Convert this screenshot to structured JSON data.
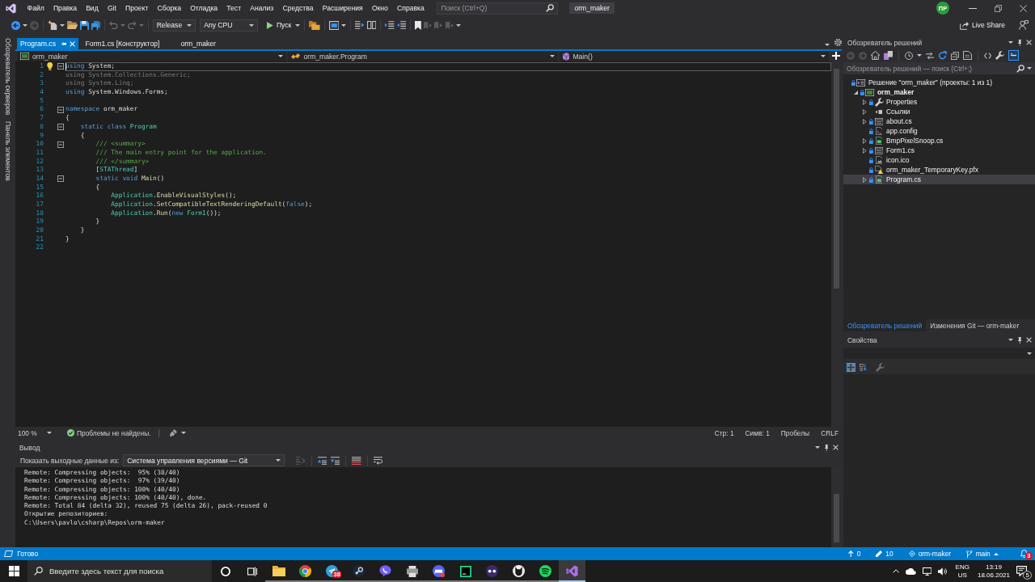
{
  "title_bar": {
    "menu": [
      "Файл",
      "Правка",
      "Вид",
      "Git",
      "Проект",
      "Сборка",
      "Отладка",
      "Тест",
      "Анализ",
      "Средства",
      "Расширения",
      "Окно",
      "Справка"
    ],
    "search": {
      "placeholder": "Поиск (Ctrl+Q)"
    },
    "solution_name": "orm_maker",
    "user_initials": "ПР"
  },
  "toolbar": {
    "configuration": "Release",
    "platform": "Any CPU",
    "start": "Пуск",
    "live_share": "Live Share"
  },
  "side_tabs": [
    "Обозреватель серверов",
    "Панель элементов"
  ],
  "editor": {
    "tabs": [
      {
        "label": "Program.cs",
        "selected": true
      },
      {
        "label": "Form1.cs [Конструктор]",
        "selected": false
      },
      {
        "label": "orm_maker",
        "selected": false
      }
    ],
    "navigation": [
      {
        "kind": "project",
        "label": "orm_maker"
      },
      {
        "kind": "class",
        "label": "orm_maker.Program"
      },
      {
        "kind": "method",
        "label": "Main()"
      }
    ],
    "lines": [
      {
        "number": "1",
        "foldable": true,
        "lightbulb": true,
        "current": true,
        "tokens": [
          {
            "kind": "keyword",
            "text": "using"
          },
          {
            "kind": "plain",
            "text": " System;"
          }
        ]
      },
      {
        "number": "2",
        "foldable": false,
        "lightbulb": false,
        "current": false,
        "tokens": [
          {
            "kind": "faded",
            "text": "using System.Collections.Generic;"
          }
        ]
      },
      {
        "number": "3",
        "foldable": false,
        "lightbulb": false,
        "current": false,
        "tokens": [
          {
            "kind": "faded",
            "text": "using System.Linq;"
          }
        ]
      },
      {
        "number": "4",
        "foldable": false,
        "lightbulb": false,
        "current": false,
        "tokens": [
          {
            "kind": "keyword",
            "text": "using"
          },
          {
            "kind": "plain",
            "text": " System.Windows.Forms;"
          }
        ]
      },
      {
        "number": "5",
        "foldable": false,
        "lightbulb": false,
        "current": false
      },
      {
        "number": "6",
        "foldable": true,
        "lightbulb": false,
        "current": false,
        "tokens": [
          {
            "kind": "keyword",
            "text": "namespace"
          },
          {
            "kind": "plain",
            "text": " orm_maker"
          }
        ]
      },
      {
        "number": "7",
        "foldable": false,
        "lightbulb": false,
        "current": false,
        "tokens": [
          {
            "kind": "plain",
            "text": "{"
          }
        ]
      },
      {
        "number": "8",
        "foldable": true,
        "lightbulb": false,
        "current": false,
        "tokens": [
          {
            "kind": "keyword",
            "text": "    static class"
          },
          {
            "kind": "type",
            "text": " Program"
          }
        ]
      },
      {
        "number": "9",
        "foldable": false,
        "lightbulb": false,
        "current": false,
        "tokens": [
          {
            "kind": "plain",
            "text": "    {"
          }
        ]
      },
      {
        "number": "10",
        "foldable": true,
        "lightbulb": false,
        "current": false,
        "tokens": [
          {
            "kind": "comment",
            "text": "        /// <summary>"
          }
        ]
      },
      {
        "number": "11",
        "foldable": false,
        "lightbulb": false,
        "current": false,
        "tokens": [
          {
            "kind": "comment",
            "text": "        /// The main entry point for the application."
          }
        ]
      },
      {
        "number": "12",
        "foldable": false,
        "lightbulb": false,
        "current": false,
        "tokens": [
          {
            "kind": "comment",
            "text": "        /// </summary>"
          }
        ]
      },
      {
        "number": "13",
        "foldable": false,
        "lightbulb": false,
        "current": false,
        "tokens": [
          {
            "kind": "plain",
            "text": "        ["
          },
          {
            "kind": "type",
            "text": "STAThread"
          },
          {
            "kind": "plain",
            "text": "]"
          }
        ]
      },
      {
        "number": "14",
        "foldable": true,
        "lightbulb": false,
        "current": false,
        "tokens": [
          {
            "kind": "keyword",
            "text": "        static void"
          },
          {
            "kind": "method",
            "text": " Main"
          },
          {
            "kind": "plain",
            "text": "()"
          }
        ]
      },
      {
        "number": "15",
        "foldable": false,
        "lightbulb": false,
        "current": false,
        "tokens": [
          {
            "kind": "plain",
            "text": "        {"
          }
        ]
      },
      {
        "number": "16",
        "foldable": false,
        "lightbulb": false,
        "current": false,
        "tokens": [
          {
            "kind": "type",
            "text": "            Application"
          },
          {
            "kind": "plain",
            "text": "."
          },
          {
            "kind": "method",
            "text": "EnableVisualStyles"
          },
          {
            "kind": "plain",
            "text": "();"
          }
        ]
      },
      {
        "number": "17",
        "foldable": false,
        "lightbulb": false,
        "current": false,
        "tokens": [
          {
            "kind": "type",
            "text": "            Application"
          },
          {
            "kind": "plain",
            "text": "."
          },
          {
            "kind": "method",
            "text": "SetCompatibleTextRenderingDefault"
          },
          {
            "kind": "plain",
            "text": "("
          },
          {
            "kind": "keyword",
            "text": "false"
          },
          {
            "kind": "plain",
            "text": ");"
          }
        ]
      },
      {
        "number": "18",
        "foldable": false,
        "lightbulb": false,
        "current": false,
        "tokens": [
          {
            "kind": "type",
            "text": "            Application"
          },
          {
            "kind": "plain",
            "text": "."
          },
          {
            "kind": "method",
            "text": "Run"
          },
          {
            "kind": "plain",
            "text": "("
          },
          {
            "kind": "keyword",
            "text": "new"
          },
          {
            "kind": "type",
            "text": " Form1"
          },
          {
            "kind": "plain",
            "text": "());"
          }
        ]
      },
      {
        "number": "19",
        "foldable": false,
        "lightbulb": false,
        "current": false,
        "tokens": [
          {
            "kind": "plain",
            "text": "        }"
          }
        ]
      },
      {
        "number": "20",
        "foldable": false,
        "lightbulb": false,
        "current": false,
        "tokens": [
          {
            "kind": "plain",
            "text": "    }"
          }
        ]
      },
      {
        "number": "21",
        "foldable": false,
        "lightbulb": false,
        "current": false,
        "tokens": [
          {
            "kind": "plain",
            "text": "}"
          }
        ]
      },
      {
        "number": "22",
        "foldable": false,
        "lightbulb": false,
        "current": false
      }
    ],
    "status": {
      "zoom": "100 %",
      "issues": "Проблемы не найдены.",
      "line": "Стр: 1",
      "column": "Симв: 1",
      "indentation": "Пробелы",
      "line_endings": "CRLF"
    }
  },
  "output": {
    "title": "Вывод",
    "source_label": "Показать выходные данные из:",
    "source": "Система управления версиями — Git",
    "lines": [
      "Remote: Compressing objects:  95% (38/40)",
      "Remote: Compressing objects:  97% (39/40)",
      "Remote: Compressing objects: 100% (40/40)",
      "Remote: Compressing objects: 100% (40/40), done.",
      "Remote: Total 84 (delta 32), reused 75 (delta 26), pack-reused 0",
      "Открытие репозиториев:",
      "C:\\Users\\pavlo\\csharp\\Repos\\orm-maker"
    ]
  },
  "solution_explorer": {
    "title": "Обозреватель решений",
    "preview_on": true,
    "search": {
      "placeholder": "Обозреватель решений — поиск (Ctrl+;)"
    },
    "tree": [
      {
        "label": "Решение \"orm_maker\" (проекты: 1 из 1)",
        "kind": "solution",
        "expandable": false,
        "tracked": true,
        "selected": false,
        "children": [
          {
            "label": "orm_maker",
            "kind": "project",
            "expandable": true,
            "expanded": true,
            "tracked": true,
            "selected": false,
            "children": [
              {
                "label": "Properties",
                "kind": "properties",
                "expandable": true,
                "expanded": false,
                "tracked": true,
                "selected": false
              },
              {
                "label": "Ссылки",
                "kind": "references",
                "expandable": true,
                "expanded": false,
                "tracked": false,
                "selected": false
              },
              {
                "label": "about.cs",
                "kind": "form",
                "expandable": true,
                "expanded": false,
                "tracked": true,
                "selected": false
              },
              {
                "label": "app.config",
                "kind": "config",
                "expandable": false,
                "tracked": true,
                "selected": false
              },
              {
                "label": "BmpPixelSnoop.cs",
                "kind": "code",
                "expandable": true,
                "expanded": false,
                "tracked": true,
                "selected": false
              },
              {
                "label": "Form1.cs",
                "kind": "form",
                "expandable": true,
                "expanded": false,
                "tracked": true,
                "selected": false
              },
              {
                "label": "icon.ico",
                "kind": "image",
                "expandable": false,
                "tracked": true,
                "selected": false
              },
              {
                "label": "orm_maker_TemporaryKey.pfx",
                "kind": "certificate",
                "expandable": false,
                "tracked": true,
                "selected": false
              },
              {
                "label": "Program.cs",
                "kind": "code",
                "expandable": true,
                "expanded": false,
                "tracked": true,
                "selected": true
              }
            ]
          }
        ]
      }
    ],
    "tabs": [
      {
        "label": "Обозреватель решений",
        "selected": true
      },
      {
        "label": "Изменения Git — orm-maker",
        "selected": false
      }
    ]
  },
  "properties": {
    "title": "Свойства",
    "views": [
      {
        "kind": "categorized",
        "selected": true
      },
      {
        "kind": "alphabetical",
        "selected": false
      }
    ]
  },
  "status_bar": {
    "message": "Готово",
    "items": [
      {
        "kind": "push",
        "label": "0"
      },
      {
        "kind": "pencil",
        "label": "10"
      },
      {
        "kind": "repo",
        "label": "orm-maker"
      },
      {
        "kind": "branch",
        "label": "main"
      }
    ],
    "notifications": "3"
  },
  "taskbar": {
    "search": {
      "placeholder": "Введите здесь текст для поиска"
    },
    "apps": [
      {
        "kind": "folder",
        "running": true,
        "selected": false
      },
      {
        "kind": "ring",
        "running": true,
        "selected": false
      },
      {
        "kind": "plane",
        "running": true,
        "selected": false,
        "badge": "38"
      },
      {
        "kind": "disc",
        "running": true,
        "selected": false
      },
      {
        "kind": "bubble",
        "running": true,
        "selected": false
      },
      {
        "kind": "printer",
        "running": true,
        "selected": false
      },
      {
        "kind": "gamepad",
        "running": true,
        "selected": false
      },
      {
        "kind": "terminal",
        "running": true,
        "selected": false
      },
      {
        "kind": "dots",
        "running": true,
        "selected": false
      },
      {
        "kind": "cat",
        "running": true,
        "selected": false
      },
      {
        "kind": "arcs",
        "running": true,
        "selected": false
      },
      {
        "kind": "ribbon",
        "running": true,
        "selected": true
      }
    ],
    "language": "ENG",
    "layout": "US",
    "time": "13:19",
    "date": "18.06.2021",
    "notifications": "5"
  }
}
